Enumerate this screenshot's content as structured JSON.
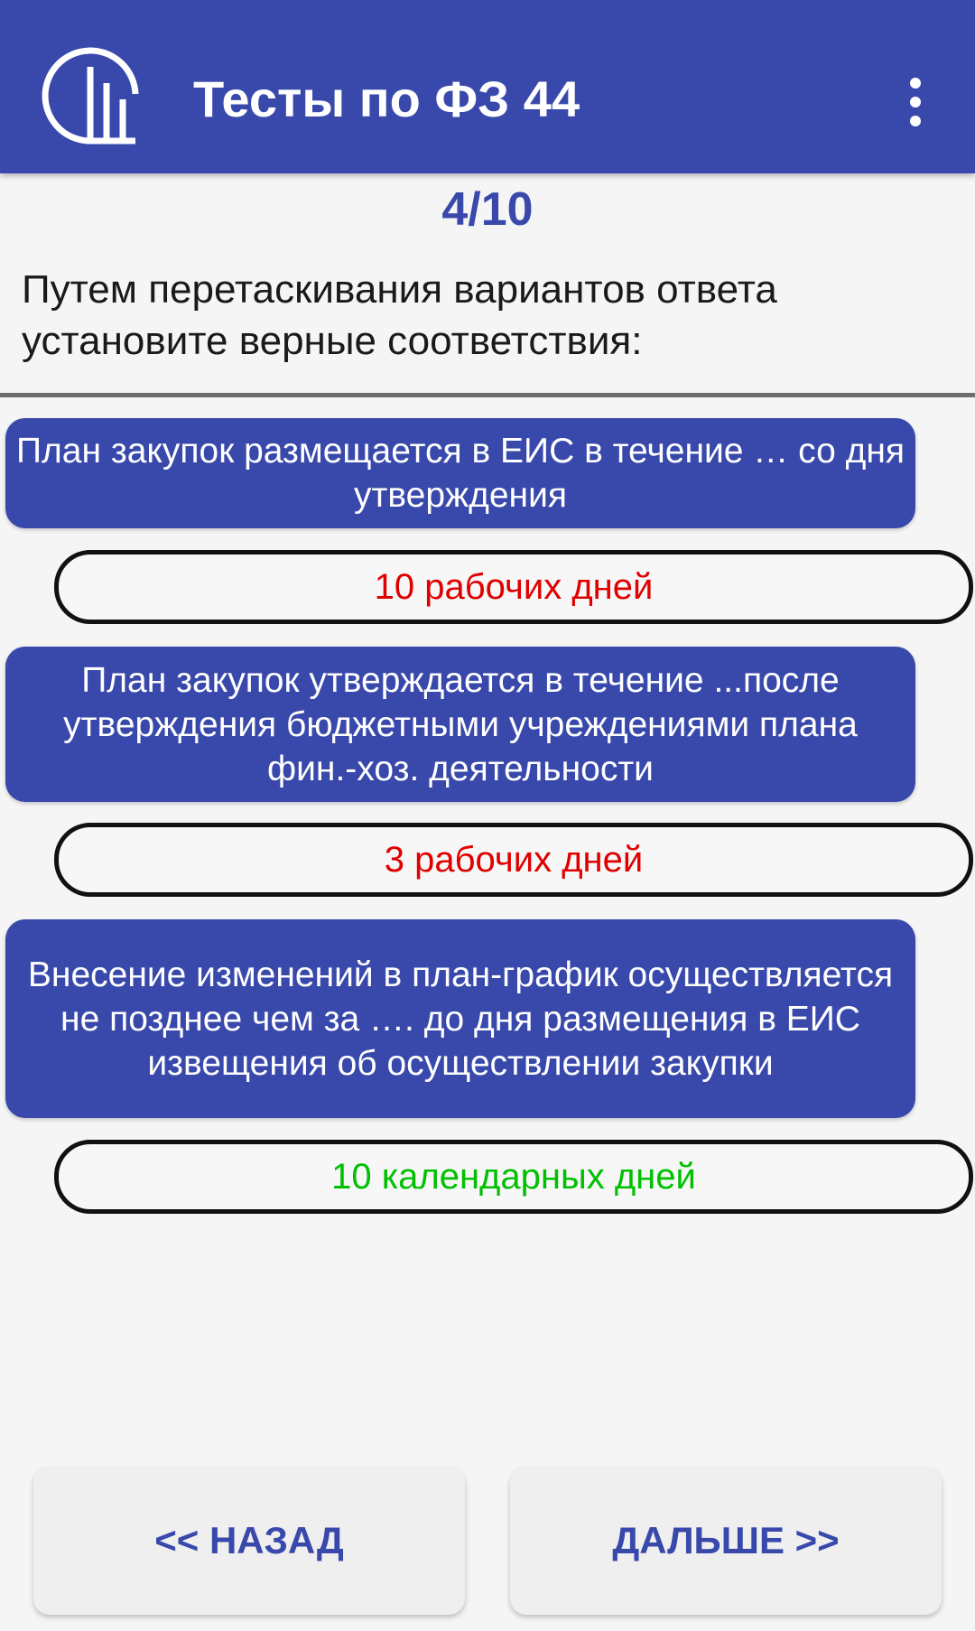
{
  "appbar": {
    "title": "Тесты по ФЗ 44",
    "logo_icon": "columns-logo-icon",
    "menu_icon": "more-vertical-icon",
    "color": "#3949ab"
  },
  "progress": "4/10",
  "question": "Путем перетаскивания вариантов ответа установите верные соответствия:",
  "pairs": [
    {
      "statement": "План закупок размещается в ЕИС в течение … со дня утверждения",
      "answer": "10 рабочих дней",
      "answer_color": "#e00000"
    },
    {
      "statement": "План закупок утверждается в течение ...после утверждения бюджетными учреждениями  плана фин.-хоз. деятельности",
      "answer": "3 рабочих дней",
      "answer_color": "#e00000"
    },
    {
      "statement": "Внесение изменений в план-график осуществляется  не позднее чем за …. до дня размещения в ЕИС извещения об осуществлении закупки",
      "answer": "10 календарных дней",
      "answer_color": "#00c000"
    }
  ],
  "buttons": {
    "back": "<< НАЗАД",
    "next": "ДАЛЬШЕ >>"
  }
}
